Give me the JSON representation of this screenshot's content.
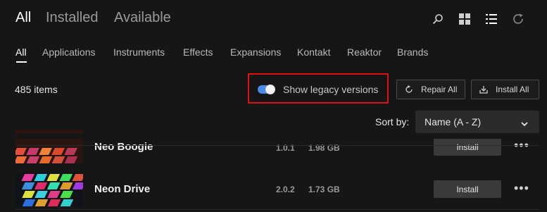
{
  "top_tabs": [
    {
      "label": "All",
      "active": true
    },
    {
      "label": "Installed",
      "active": false
    },
    {
      "label": "Available",
      "active": false
    }
  ],
  "toolbar_icons": [
    "search-icon",
    "grid-view-icon",
    "list-view-icon",
    "refresh-icon"
  ],
  "categories": [
    {
      "label": "All",
      "active": true
    },
    {
      "label": "Applications"
    },
    {
      "label": "Instruments"
    },
    {
      "label": "Effects"
    },
    {
      "label": "Expansions"
    },
    {
      "label": "Kontakt"
    },
    {
      "label": "Reaktor"
    },
    {
      "label": "Brands"
    }
  ],
  "items_count": "485 items",
  "legacy_toggle": {
    "label": "Show legacy versions",
    "on": true,
    "color": "#4a8be8"
  },
  "repair_all_label": "Repair All",
  "install_all_label": "Install All",
  "sort": {
    "label": "Sort by:",
    "value": "Name (A - Z)"
  },
  "products": [
    {
      "name": "Neo Boogie",
      "version": "1.0.1",
      "size": "1.98 GB",
      "action": "Install"
    },
    {
      "name": "Neon Drive",
      "version": "2.0.2",
      "size": "1.73 GB",
      "action": "Install"
    }
  ],
  "colors": {
    "highlight_border": "#e01010",
    "background": "#161616"
  }
}
